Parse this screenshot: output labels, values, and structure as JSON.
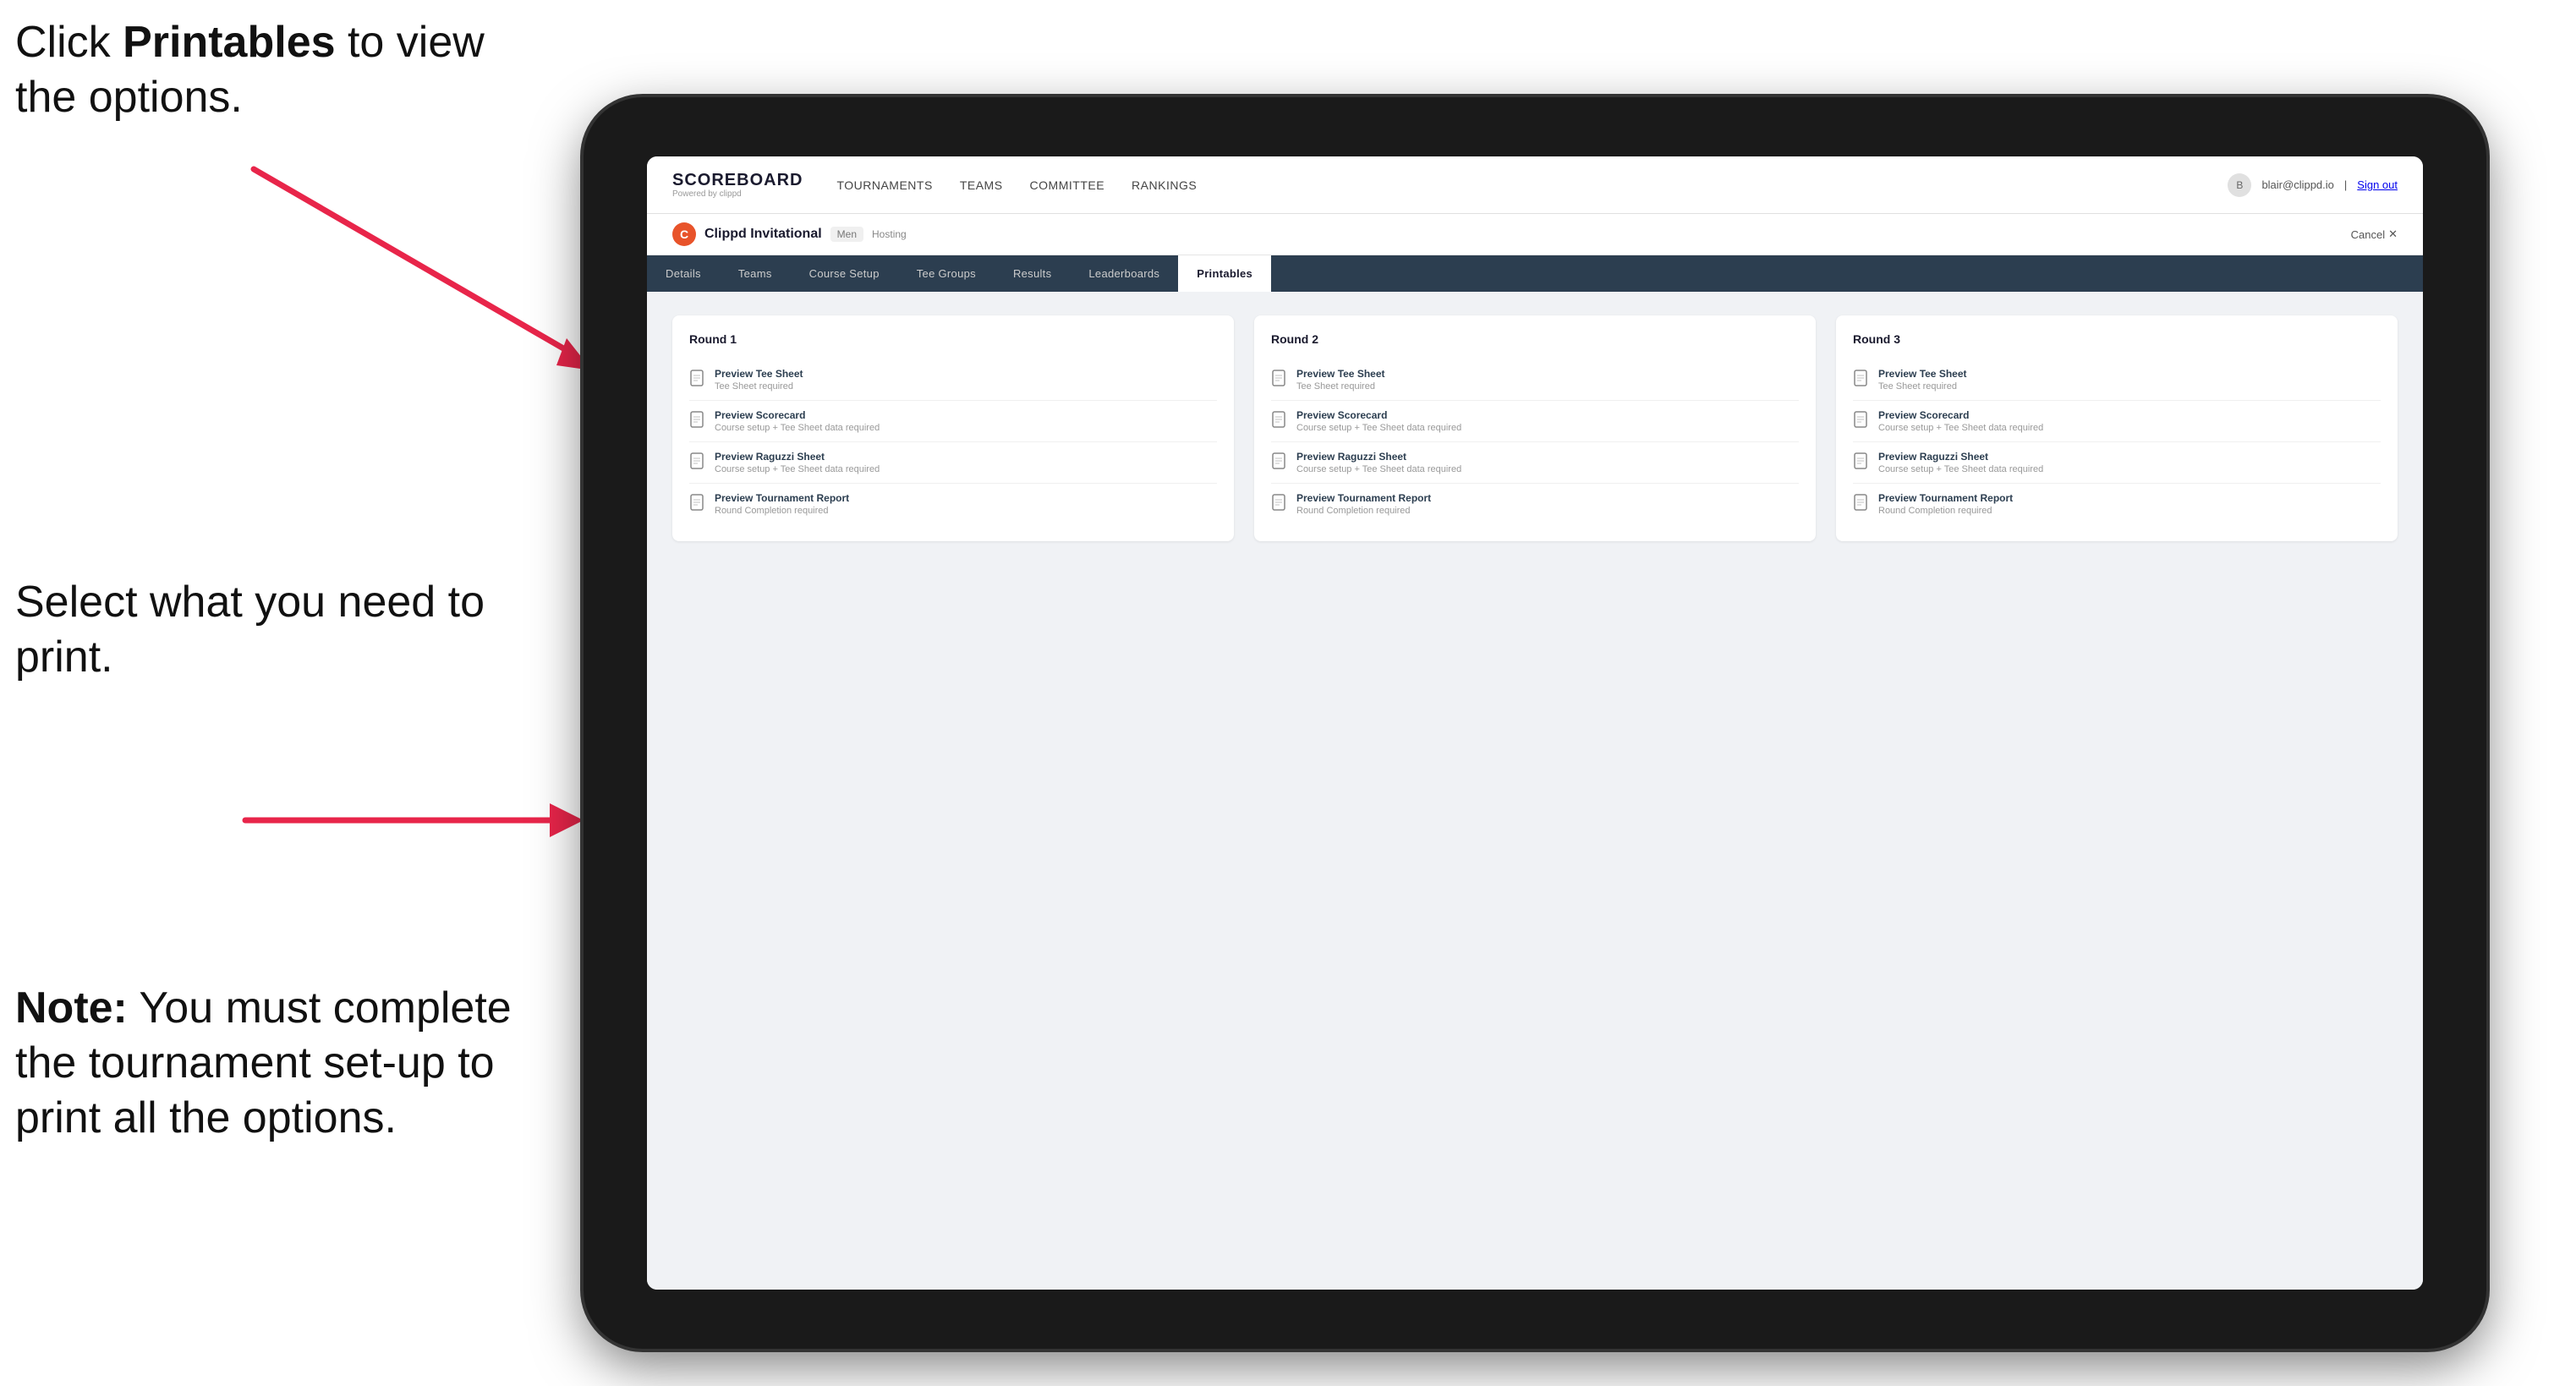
{
  "instructions": {
    "top": "Click ",
    "top_bold": "Printables",
    "top_end": " to view the options.",
    "middle": "Select what you need to print.",
    "bottom_bold": "Note:",
    "bottom_end": " You must complete the tournament set-up to print all the options."
  },
  "nav": {
    "brand": "SCOREBOARD",
    "brand_sub": "Powered by clippd",
    "links": [
      "TOURNAMENTS",
      "TEAMS",
      "COMMITTEE",
      "RANKINGS"
    ],
    "user_email": "blair@clippd.io",
    "sign_out": "Sign out"
  },
  "tournament": {
    "logo_letter": "C",
    "name": "Clippd Invitational",
    "badge": "Men",
    "status": "Hosting",
    "cancel": "Cancel"
  },
  "tabs": [
    "Details",
    "Teams",
    "Course Setup",
    "Tee Groups",
    "Results",
    "Leaderboards",
    "Printables"
  ],
  "active_tab": "Printables",
  "rounds": [
    {
      "title": "Round 1",
      "items": [
        {
          "title": "Preview Tee Sheet",
          "subtitle": "Tee Sheet required"
        },
        {
          "title": "Preview Scorecard",
          "subtitle": "Course setup + Tee Sheet data required"
        },
        {
          "title": "Preview Raguzzi Sheet",
          "subtitle": "Course setup + Tee Sheet data required"
        },
        {
          "title": "Preview Tournament Report",
          "subtitle": "Round Completion required"
        }
      ]
    },
    {
      "title": "Round 2",
      "items": [
        {
          "title": "Preview Tee Sheet",
          "subtitle": "Tee Sheet required"
        },
        {
          "title": "Preview Scorecard",
          "subtitle": "Course setup + Tee Sheet data required"
        },
        {
          "title": "Preview Raguzzi Sheet",
          "subtitle": "Course setup + Tee Sheet data required"
        },
        {
          "title": "Preview Tournament Report",
          "subtitle": "Round Completion required"
        }
      ]
    },
    {
      "title": "Round 3",
      "items": [
        {
          "title": "Preview Tee Sheet",
          "subtitle": "Tee Sheet required"
        },
        {
          "title": "Preview Scorecard",
          "subtitle": "Course setup + Tee Sheet data required"
        },
        {
          "title": "Preview Raguzzi Sheet",
          "subtitle": "Course setup + Tee Sheet data required"
        },
        {
          "title": "Preview Tournament Report",
          "subtitle": "Round Completion required"
        }
      ]
    }
  ]
}
